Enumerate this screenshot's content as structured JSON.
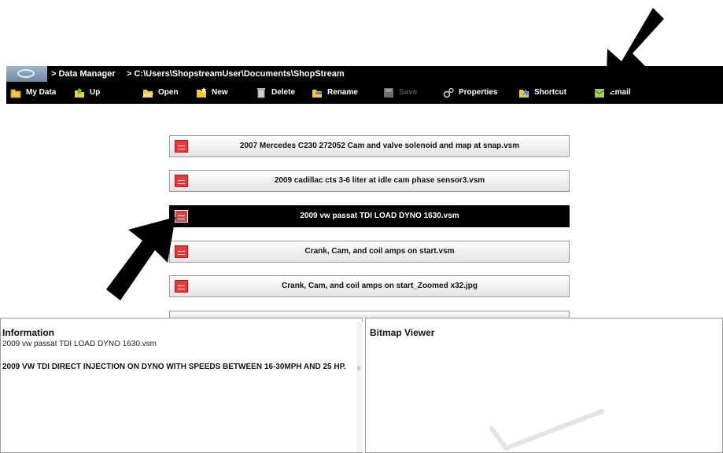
{
  "titlebar": {
    "crumb1": "> Data Manager",
    "crumb2": "> C:\\Users\\ShopstreamUser\\Documents\\ShopStream"
  },
  "toolbar": {
    "my_data": "My Data",
    "up": "Up",
    "open": "Open",
    "new": "New",
    "delete": "Delete",
    "rename": "Rename",
    "save": "Save",
    "properties": "Properties",
    "shortcut": "Shortcut",
    "email": "Email"
  },
  "files": [
    "2007 Mercedes C230 272052 Cam and valve solenoid and map at snap.vsm",
    "2009 cadillac cts 3-6 liter at idle cam phase sensor3.vsm",
    "2009 vw passat TDI LOAD DYNO 1630.vsm",
    "Crank, Cam, and coil amps on start.vsm",
    "Crank, Cam, and coil amps on start_Zoomed x32.jpg"
  ],
  "information": {
    "title": "Information",
    "filename": "2009 vw passat TDI LOAD DYNO 1630.vsm",
    "description": "2009 VW TDI  DIRECT INJECTION ON DYNO WITH SPEEDS BETWEEN 16-30MPH AND 25 HP."
  },
  "bitmap_viewer": {
    "title": "Bitmap Viewer"
  },
  "colors": {
    "bar": "#000000",
    "file_icon": "#e23b3b",
    "selected_row": "#000000"
  }
}
